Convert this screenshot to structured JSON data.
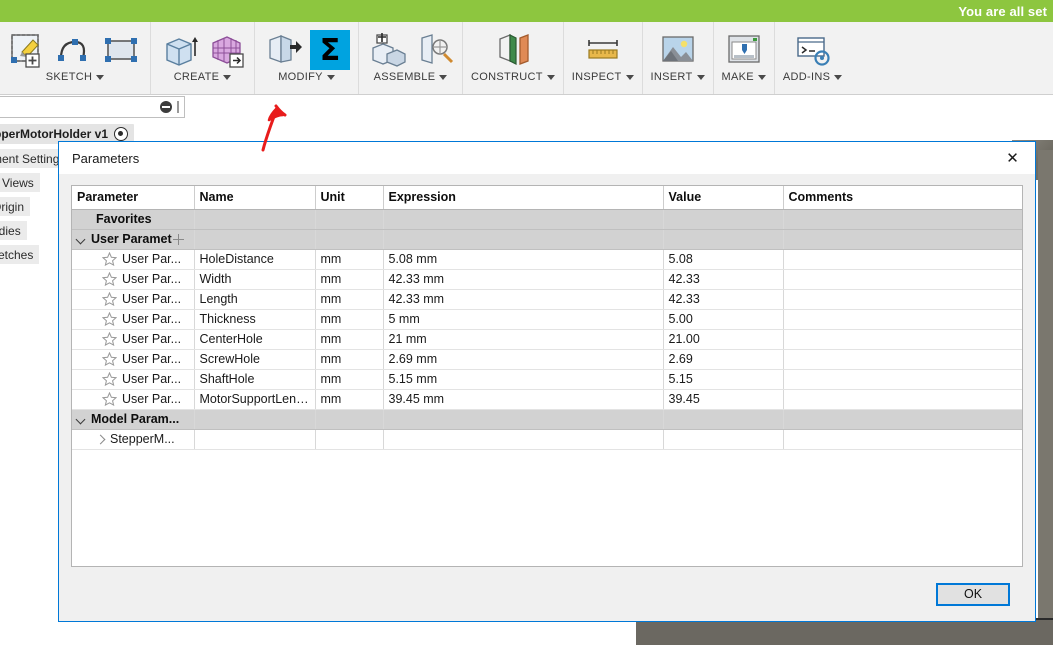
{
  "banner": {
    "text": "You are all set"
  },
  "ribbon": {
    "groups": [
      {
        "label": "SKETCH",
        "icons": [
          "create-sketch-icon",
          "spline-icon",
          "rectangle-icon"
        ]
      },
      {
        "label": "CREATE",
        "icons": [
          "extrude-icon",
          "mesh-create-icon"
        ]
      },
      {
        "label": "MODIFY",
        "icons": [
          "press-pull-icon",
          "change-parameters-icon"
        ]
      },
      {
        "label": "ASSEMBLE",
        "icons": [
          "new-component-icon",
          "joint-icon"
        ]
      },
      {
        "label": "CONSTRUCT",
        "icons": [
          "offset-plane-icon"
        ]
      },
      {
        "label": "INSPECT",
        "icons": [
          "measure-icon"
        ]
      },
      {
        "label": "INSERT",
        "icons": [
          "insert-image-icon"
        ]
      },
      {
        "label": "MAKE",
        "icons": [
          "3d-print-icon"
        ]
      },
      {
        "label": "ADD-INS",
        "icons": [
          "scripts-addins-icon"
        ]
      }
    ]
  },
  "browser": {
    "root_label": "pperMotorHolder v1",
    "items": [
      {
        "label": "ment Settings"
      },
      {
        "label": "d Views"
      },
      {
        "label": "Origin"
      },
      {
        "label": "odies"
      },
      {
        "label": "ketches"
      }
    ]
  },
  "dialog": {
    "title": "Parameters",
    "close_label": "✕",
    "ok_label": "OK",
    "columns": [
      "Parameter",
      "Name",
      "Unit",
      "Expression",
      "Value",
      "Comments"
    ],
    "rows": [
      {
        "kind": "group",
        "indent": 1,
        "chevron": "none",
        "parameter": "Favorites",
        "name": "",
        "unit": "",
        "expression": "",
        "value": "",
        "comments": ""
      },
      {
        "kind": "group",
        "indent": 1,
        "chevron": "down",
        "parameter": "User Paramet",
        "name": "",
        "unit": "",
        "expression": "",
        "value": "",
        "comments": "",
        "truncation_icon": "plus-marker"
      },
      {
        "kind": "param",
        "indent": 2,
        "star": true,
        "parameter": "User Par...",
        "name": "HoleDistance",
        "unit": "mm",
        "expression": "5.08 mm",
        "value": "5.08",
        "comments": ""
      },
      {
        "kind": "param",
        "indent": 2,
        "star": true,
        "parameter": "User Par...",
        "name": "Width",
        "unit": "mm",
        "expression": "42.33 mm",
        "value": "42.33",
        "comments": ""
      },
      {
        "kind": "param",
        "indent": 2,
        "star": true,
        "parameter": "User Par...",
        "name": "Length",
        "unit": "mm",
        "expression": "42.33 mm",
        "value": "42.33",
        "comments": ""
      },
      {
        "kind": "param",
        "indent": 2,
        "star": true,
        "parameter": "User Par...",
        "name": "Thickness",
        "unit": "mm",
        "expression": "5 mm",
        "value": "5.00",
        "comments": ""
      },
      {
        "kind": "param",
        "indent": 2,
        "star": true,
        "parameter": "User Par...",
        "name": "CenterHole",
        "unit": "mm",
        "expression": "21 mm",
        "value": "21.00",
        "comments": ""
      },
      {
        "kind": "param",
        "indent": 2,
        "star": true,
        "parameter": "User Par...",
        "name": "ScrewHole",
        "unit": "mm",
        "expression": "2.69 mm",
        "value": "2.69",
        "comments": ""
      },
      {
        "kind": "param",
        "indent": 2,
        "star": true,
        "parameter": "User Par...",
        "name": "ShaftHole",
        "unit": "mm",
        "expression": "5.15 mm",
        "value": "5.15",
        "comments": ""
      },
      {
        "kind": "param",
        "indent": 2,
        "star": true,
        "parameter": "User Par...",
        "name": "MotorSupportLength",
        "unit": "mm",
        "expression": "39.45 mm",
        "value": "39.45",
        "comments": ""
      },
      {
        "kind": "group",
        "indent": 1,
        "chevron": "down",
        "parameter": "Model Param...",
        "name": "",
        "unit": "",
        "expression": "",
        "value": "",
        "comments": ""
      },
      {
        "kind": "sub",
        "indent": 2,
        "chevron": "right",
        "parameter": "StepperM...",
        "name": "",
        "unit": "",
        "expression": "",
        "value": "",
        "comments": ""
      }
    ]
  },
  "colors": {
    "banner_green": "#8dc63f",
    "dialog_border_blue": "#0078d7",
    "highlight_cyan": "#00a3e0",
    "annotation_red": "#e81c1c",
    "group_row_gray": "#d2d2d2"
  }
}
